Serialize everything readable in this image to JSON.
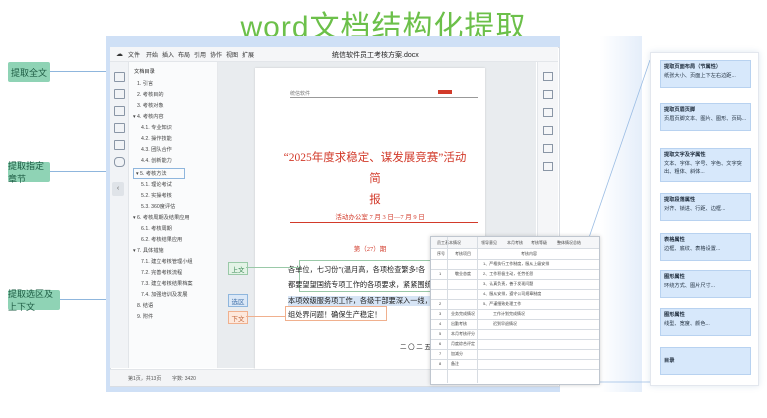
{
  "title": "word文档结构化提取",
  "side_labels": {
    "full_text": "提取全文",
    "chapter": "提取指定章节",
    "context": "提取选区及上下文"
  },
  "window": {
    "doc_title": "统信软件员工考核方案.docx",
    "menu": [
      "文件",
      "开始",
      "插入",
      "布局",
      "引用",
      "协作",
      "视图",
      "扩展"
    ]
  },
  "nav": {
    "items": [
      "文档目录",
      "1. 引言",
      "2. 考核目的",
      "3. 考核对象",
      "4. 考核内容",
      "4.1. 专业知识",
      "4.2. 操作技能",
      "4.3. 团队合作",
      "4.4. 创新能力",
      "5. 考核方法",
      "5.1. 理论考试",
      "5.2. 实操考核",
      "5.3. 360度评估",
      "6. 考核周期及结果应用",
      "6.1. 考核周期",
      "6.2. 考核结果应用",
      "7. 具体措施",
      "7.1. 建立考核管理小组",
      "7.2. 完善考核流程",
      "7.3. 建立考核结果档案",
      "7.4. 加强培训及发展",
      "8. 结语",
      "9. 附件"
    ]
  },
  "status": {
    "page": "第1页，共13页",
    "words": "字数: 3420"
  },
  "document": {
    "header_left": "统信软件",
    "heading": "“2025年度求稳定、谋发展竞赛”活动简报",
    "heading_line1": "“2025年度求稳定、谋发展竞赛”活动简",
    "heading_line2": "报",
    "sub": "活动办公室 7 月 3 日—7 月 9 日",
    "issue": "第（27）期",
    "body_lines": [
      "各单位，七习份”(温月高，各项检查繁多!各",
      "都要望望国统专项工作的各项要求，紧紧围统提",
      "本项效级服务项工作，各级干部要深入一线，下",
      "组处界问题！确保生产稳定！"
    ],
    "footer_date": "二 〇 二 五"
  },
  "tags": {
    "above": "上文",
    "selection": "选区",
    "below": "下文"
  },
  "table": {
    "header": [
      "员工基本情况",
      "领导意见",
      "本月考核",
      "考核等级",
      "整体情况总结"
    ],
    "rows": [
      [
        "序号",
        "考核项目",
        "考核内容"
      ],
      [
        "",
        "",
        "1、严格执行工作制度，服从上级安排"
      ],
      [
        "1",
        "敬业态度",
        "2、工作积极主动，任劳任怨"
      ],
      [
        "",
        "",
        "3、认真负责，善于发现问题"
      ],
      [
        "",
        "",
        "4、服从安排，遵守公司规章制度"
      ],
      [
        "2",
        "",
        "5、严谨细致处理工作"
      ],
      [
        "3",
        "业务完成情况",
        "工作计划完成情况"
      ],
      [
        "4",
        "出勤考核",
        "迟到早退情况"
      ],
      [
        "5",
        "本月考核评分",
        ""
      ],
      [
        "6",
        "月度综合评定",
        ""
      ],
      [
        "7",
        "加减分",
        ""
      ],
      [
        "8",
        "备注",
        ""
      ]
    ]
  },
  "cards": [
    {
      "title": "提取页面布局（节属性）",
      "desc": "纸张大小、页面上下左右边距..."
    },
    {
      "title": "提取页眉页脚",
      "desc": "页眉页脚文本、图片、图形、页码..."
    },
    {
      "title": "提取文字及字属性",
      "desc": "文本、字体、字号、字色、文字突出、粗体、斜体..."
    },
    {
      "title": "提取段落属性",
      "desc": "对齐、锁进、行距、边框..."
    },
    {
      "title": "表格属性",
      "desc": "边框、底纹、表格设置..."
    },
    {
      "title": "图形属性",
      "desc": "环绕方式、图片尺寸..."
    },
    {
      "title": "图形属性",
      "desc": "线型、宽度、颜色..."
    },
    {
      "title": "目录",
      "desc": ""
    }
  ],
  "colors": {
    "title_green": "#6cc04a",
    "label_green": "#8fd3b5",
    "doc_red": "#d23a2a",
    "card_blue": "#d7e8fb"
  }
}
